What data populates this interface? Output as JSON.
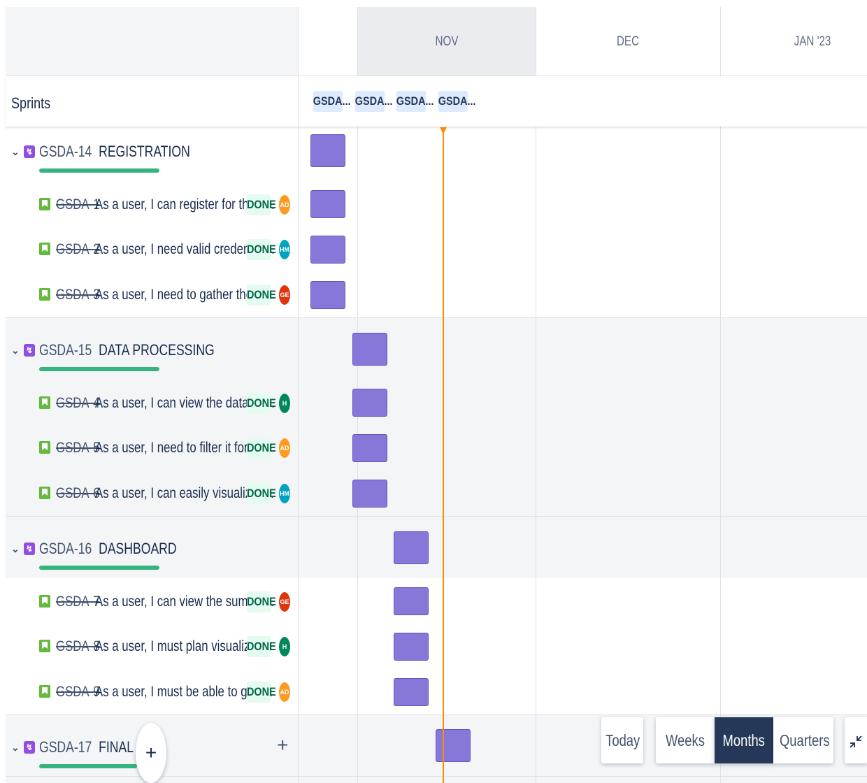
{
  "timeline": {
    "months": [
      "NOV",
      "DEC",
      "JAN '23"
    ],
    "sprints_label": "Sprints",
    "sprints": [
      "GSDA...",
      "GSDA...",
      "GSDA...",
      "GSDA..."
    ]
  },
  "epics": [
    {
      "key": "GSDA-14",
      "name": "REGISTRATION",
      "progress": 1.0,
      "stories": [
        {
          "key": "GSDA-1",
          "summary": "As a user, I can register for the a...",
          "status": "DONE",
          "assignee": "AD",
          "color": "#ff991f"
        },
        {
          "key": "GSDA-2",
          "summary": "As a user, I need valid credential...",
          "status": "DONE",
          "assignee": "HM",
          "color": "#00a3bf"
        },
        {
          "key": "GSDA-3",
          "summary": "As a user, I need to gather the d...",
          "status": "DONE",
          "assignee": "GE",
          "color": "#de350b"
        }
      ]
    },
    {
      "key": "GSDA-15",
      "name": "DATA PROCESSING",
      "progress": 1.0,
      "stories": [
        {
          "key": "GSDA-4",
          "summary": "As a user, I can view the data of ...",
          "status": "DONE",
          "assignee": "H",
          "color": "#00875a"
        },
        {
          "key": "GSDA-5",
          "summary": "As a user, I need to filter it for D...",
          "status": "DONE",
          "assignee": "AD",
          "color": "#ff991f"
        },
        {
          "key": "GSDA-6",
          "summary": "As a user, I can easily visualize t...",
          "status": "DONE",
          "assignee": "HM",
          "color": "#00a3bf"
        }
      ]
    },
    {
      "key": "GSDA-16",
      "name": "DASHBOARD",
      "progress": 1.0,
      "stories": [
        {
          "key": "GSDA-7",
          "summary": "As a user, I can view the summa...",
          "status": "DONE",
          "assignee": "GE",
          "color": "#de350b"
        },
        {
          "key": "GSDA-8",
          "summary": "As a user, I must plan visualizati...",
          "status": "DONE",
          "assignee": "H",
          "color": "#00875a"
        },
        {
          "key": "GSDA-9",
          "summary": "As a user, I must be able to gain...",
          "status": "DONE",
          "assignee": "AD",
          "color": "#ff991f"
        }
      ]
    },
    {
      "key": "GSDA-17",
      "name": "FINAL",
      "progress": 1.0,
      "stories": []
    }
  ],
  "controls": {
    "today": "Today",
    "weeks": "Weeks",
    "months": "Months",
    "quarters": "Quarters",
    "active": "Months",
    "add_symbol": "+",
    "create_symbol": "+"
  },
  "colors": {
    "bar": "#8777d9",
    "today_line": "#ff8b00",
    "epic": "#904ee2",
    "story": "#63ba3c",
    "active_ctrl": "#253858"
  }
}
